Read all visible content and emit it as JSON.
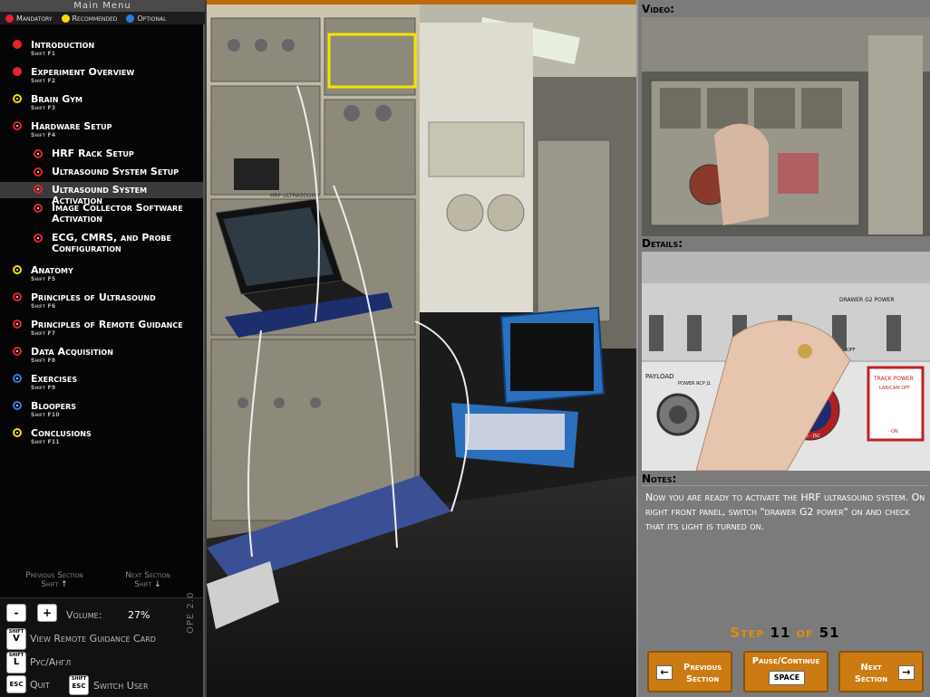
{
  "menu": {
    "title": "Main Menu",
    "legend": [
      {
        "label": "Mandatory",
        "color": "#e8212a"
      },
      {
        "label": "Recommended",
        "color": "#f0e000"
      },
      {
        "label": "Optional",
        "color": "#2a7de0"
      }
    ],
    "sections": [
      {
        "label": "Introduction",
        "shortcut": "Shift F1",
        "bullet": "filled-red"
      },
      {
        "label": "Experiment Overview",
        "shortcut": "Shift F2",
        "bullet": "filled-red"
      },
      {
        "label": "Brain Gym",
        "shortcut": "Shift F3",
        "bullet": "ring-yellow"
      },
      {
        "label": "Hardware Setup",
        "shortcut": "Shift F4",
        "bullet": "ring-red"
      }
    ],
    "subsections": [
      {
        "label": "HRF Rack Setup"
      },
      {
        "label": "Ultrasound System Setup"
      },
      {
        "label": "Ultrasound System Activation",
        "active": true
      },
      {
        "label": "Image Collector Software Activation"
      },
      {
        "label": "ECG, CMRS, and  Probe Configuration"
      }
    ],
    "sections_after": [
      {
        "label": "Anatomy",
        "shortcut": "Shift F5",
        "bullet": "ring-yellow"
      },
      {
        "label": "Principles of Ultrasound",
        "shortcut": "Shift F6",
        "bullet": "ring-red"
      },
      {
        "label": "Principles of Remote Guidance",
        "shortcut": "Shift F7",
        "bullet": "ring-red"
      },
      {
        "label": "Data Acquisition",
        "shortcut": "Shift F8",
        "bullet": "ring-red"
      },
      {
        "label": "Exercises",
        "shortcut": "Shift F9",
        "bullet": "ring-blue"
      },
      {
        "label": "Bloopers",
        "shortcut": "Shift F10",
        "bullet": "ring-blue"
      },
      {
        "label": "Conclusions",
        "shortcut": "Shift F11",
        "bullet": "ring-yellow"
      }
    ],
    "previous_section": "Previous Section",
    "previous_shortcut": "Shift",
    "next_section": "Next Section",
    "next_shortcut": "Shift"
  },
  "controls": {
    "minus": "-",
    "plus": "+",
    "volume_label": "Volume:",
    "volume_value": "27%",
    "view_card_key": "V",
    "view_card_label": "View Remote Guidance Card",
    "lang_key": "L",
    "lang_label": "Рус/Англ",
    "quit_key": "ESC",
    "quit_label": "Quit",
    "switch_key": "ESC",
    "switch_label": "Switch User",
    "shift_tag": "SHIFT",
    "version": "OPE 2.0"
  },
  "main_image": {
    "alt_labels": [
      "HRF ULTRASOUND"
    ]
  },
  "right": {
    "video_header": "Video:",
    "details_header": "Details:",
    "notes_header": "Notes:",
    "notes_text": "Now you are ready to activate the HRF ultrasound system. On right front panel, switch \"drawer G2 power\" on and check that its light is turned on.",
    "details_labels": [
      "DRAWER G2 POWER",
      "PAYLOAD",
      "POWER RCP J1",
      "TRACK POWER",
      "LAB/CAM OFF",
      "ON",
      "NASA - JSC",
      "OFF"
    ],
    "step_word": "Step",
    "step_current": "11",
    "step_of": "of",
    "step_total": "51"
  },
  "nav": {
    "prev_label_1": "Previous",
    "prev_label_2": "Section",
    "pause_label": "Pause/Continue",
    "pause_key": "SPACE",
    "next_label_1": "Next",
    "next_label_2": "Section"
  },
  "colors": {
    "accent_orange": "#cc7b12",
    "step_orange": "#e08a10",
    "highlight_yellow": "#f2e400"
  }
}
